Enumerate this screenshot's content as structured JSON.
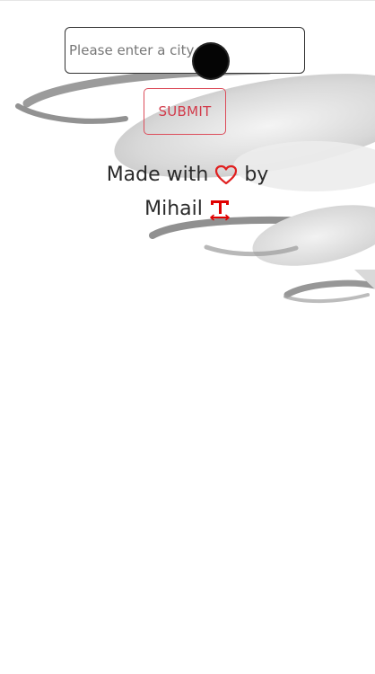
{
  "search": {
    "placeholder": "Please enter a city"
  },
  "submit": {
    "label": "SUBMIT"
  },
  "footer": {
    "made_with": "Made with",
    "by": "by",
    "author": "Mihail"
  },
  "icons": {
    "heart": "heart-icon",
    "logo": "t-logo-icon"
  },
  "colors": {
    "accent": "#d23b4b",
    "heart": "#e02020",
    "logo": "#e00000"
  }
}
